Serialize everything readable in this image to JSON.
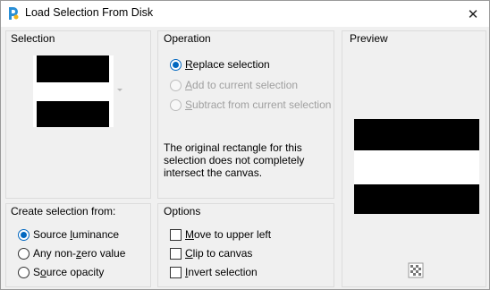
{
  "window": {
    "title": "Load Selection From Disk",
    "close_symbol": "✕"
  },
  "selection": {
    "title": "Selection"
  },
  "operation": {
    "title": "Operation",
    "options": [
      {
        "pre": "",
        "u": "R",
        "post": "eplace selection",
        "checked": true,
        "enabled": true
      },
      {
        "pre": "",
        "u": "A",
        "post": "dd to current selection",
        "checked": false,
        "enabled": false
      },
      {
        "pre": "",
        "u": "S",
        "post": "ubtract from current selection",
        "checked": false,
        "enabled": false
      }
    ],
    "note": "The original rectangle for this selection does not completely intersect the canvas."
  },
  "preview": {
    "title": "Preview"
  },
  "create_from": {
    "title": "Create selection from:",
    "options": [
      {
        "pre": "Source ",
        "u": "l",
        "post": "uminance",
        "checked": true
      },
      {
        "pre": "Any non-",
        "u": "z",
        "post": "ero value",
        "checked": false
      },
      {
        "pre": "S",
        "u": "o",
        "post": "urce opacity",
        "checked": false
      }
    ]
  },
  "options": {
    "title": "Options",
    "items": [
      {
        "pre": "",
        "u": "M",
        "post": "ove to upper left",
        "checked": false
      },
      {
        "pre": "",
        "u": "C",
        "post": "lip to canvas",
        "checked": false
      },
      {
        "pre": "",
        "u": "I",
        "post": "nvert selection",
        "checked": false
      }
    ]
  },
  "icons": {
    "app": "paintshop-pro-icon",
    "close": "close-icon",
    "zoom": "checkerboard-zoom-icon",
    "dropdown": "chevron-down-icon"
  },
  "colors": {
    "accent": "#0067c0",
    "disabled": "#a0a0a0"
  }
}
